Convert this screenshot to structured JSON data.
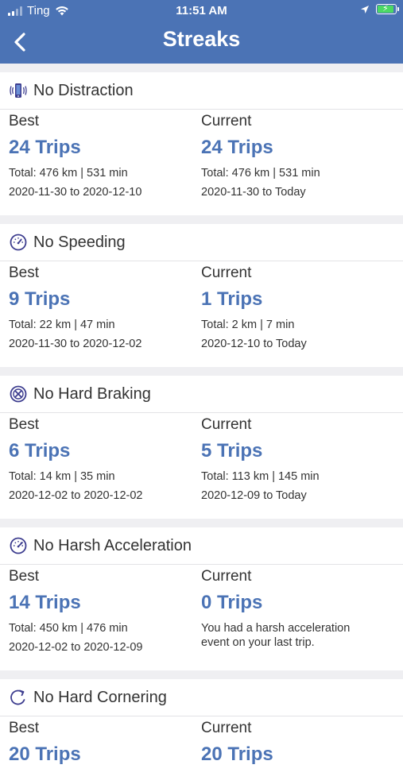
{
  "status_bar": {
    "carrier": "Ting",
    "time": "11:51 AM"
  },
  "nav": {
    "title": "Streaks"
  },
  "colors": {
    "accent": "#4b73b5",
    "battery": "#4cd964"
  },
  "streaks": [
    {
      "title": "No Distraction",
      "icon": "phone-vibrate-icon",
      "best": {
        "label": "Best",
        "trips": "24 Trips",
        "total": "Total: 476 km | 531 min",
        "range": "2020-11-30 to 2020-12-10"
      },
      "current": {
        "label": "Current",
        "trips": "24 Trips",
        "total": "Total: 476 km | 531 min",
        "range": "2020-11-30 to Today"
      }
    },
    {
      "title": "No Speeding",
      "icon": "speedometer-icon",
      "best": {
        "label": "Best",
        "trips": "9 Trips",
        "total": "Total: 22 km | 47 min",
        "range": "2020-11-30 to 2020-12-02"
      },
      "current": {
        "label": "Current",
        "trips": "1 Trips",
        "total": "Total: 2 km | 7 min",
        "range": "2020-12-10 to Today"
      }
    },
    {
      "title": "No Hard Braking",
      "icon": "brake-icon",
      "best": {
        "label": "Best",
        "trips": "6 Trips",
        "total": "Total: 14 km | 35 min",
        "range": "2020-12-02 to 2020-12-02"
      },
      "current": {
        "label": "Current",
        "trips": "5 Trips",
        "total": "Total: 113 km | 145 min",
        "range": "2020-12-09 to Today"
      }
    },
    {
      "title": "No Harsh Acceleration",
      "icon": "acceleration-icon",
      "best": {
        "label": "Best",
        "trips": "14 Trips",
        "total": "Total: 450 km | 476 min",
        "range": "2020-12-02 to 2020-12-09"
      },
      "current": {
        "label": "Current",
        "trips": "0 Trips",
        "note": "You had a harsh acceleration event on your last trip."
      }
    },
    {
      "title": "No Hard Cornering",
      "icon": "cornering-icon",
      "best": {
        "label": "Best",
        "trips": "20 Trips"
      },
      "current": {
        "label": "Current",
        "trips": "20 Trips"
      }
    }
  ]
}
